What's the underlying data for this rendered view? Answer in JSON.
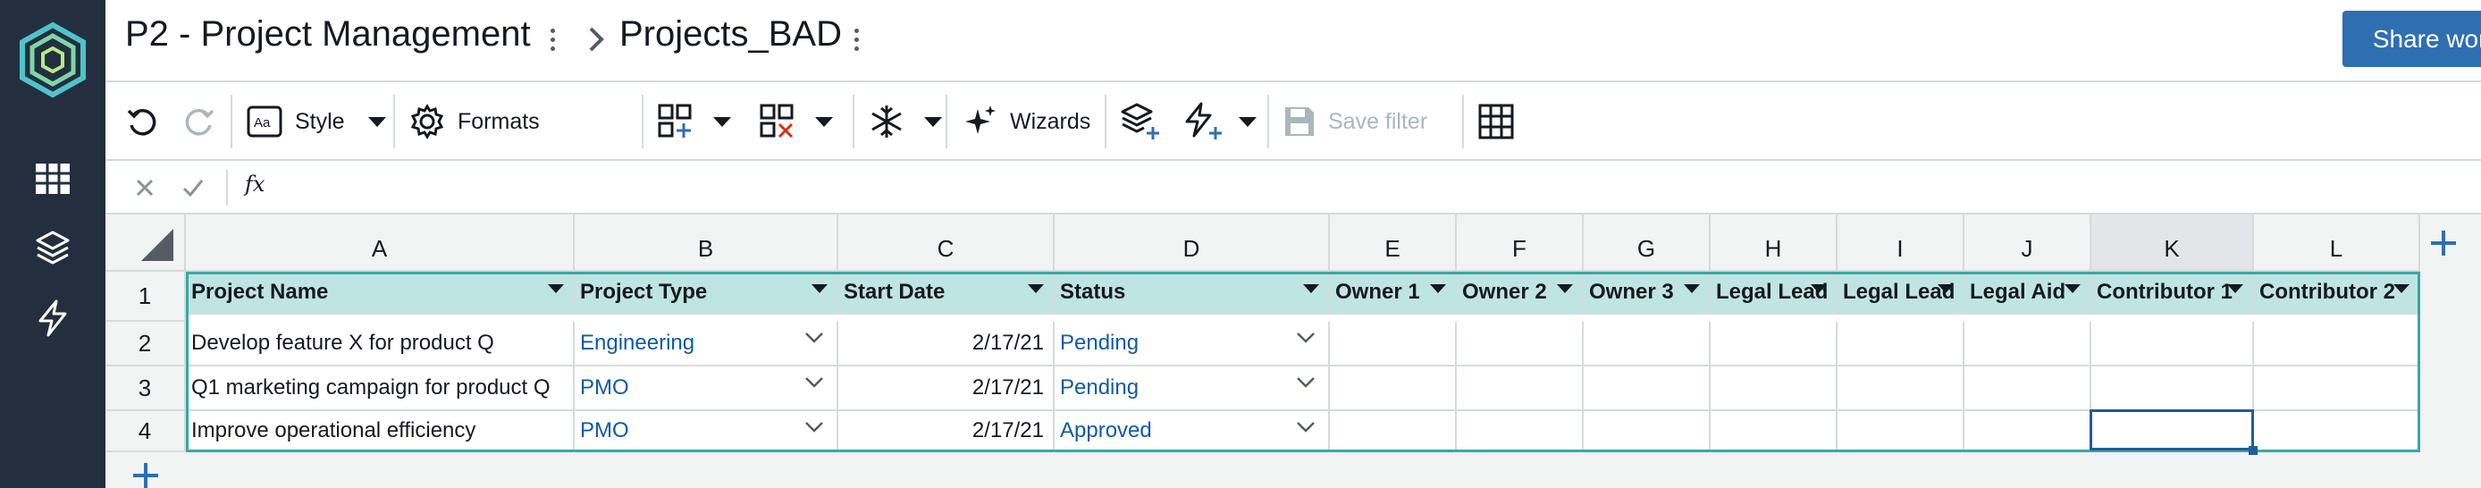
{
  "header": {
    "workbook_title": "P2 - Project Management",
    "sheet_title": "Projects_BAD",
    "share_label": "Share workbook"
  },
  "toolbar": {
    "style_label": "Style",
    "formats_label": "Formats",
    "wizards_label": "Wizards",
    "save_filter_label": "Save filter"
  },
  "formula_bar": {
    "fx_label": "fx",
    "value": ""
  },
  "grid": {
    "columns": [
      "A",
      "B",
      "C",
      "D",
      "E",
      "F",
      "G",
      "H",
      "I",
      "J",
      "K",
      "L"
    ],
    "rows": [
      "1",
      "2",
      "3",
      "4"
    ],
    "header_row": [
      "Project Name",
      "Project Type",
      "Start Date",
      "Status",
      "Owner 1",
      "Owner 2",
      "Owner 3",
      "Legal Lead",
      "Legal Lead",
      "Legal Aid",
      "Contributor 1",
      "Contributor 2"
    ],
    "data": [
      {
        "name": "Develop feature X for product Q",
        "type": "Engineering",
        "start": "2/17/21",
        "status": "Pending"
      },
      {
        "name": "Q1 marketing campaign for product Q",
        "type": "PMO",
        "start": "2/17/21",
        "status": "Pending"
      },
      {
        "name": "Improve operational efficiency",
        "type": "PMO",
        "start": "2/17/21",
        "status": "Approved"
      }
    ],
    "selected_cell": "K4"
  },
  "colors": {
    "nav_bg": "#232f3e",
    "accent_blue": "#2e6fb2",
    "table_header_bg": "#bfe5e3",
    "table_outline": "#3aa7a6",
    "link_text": "#0f5aa6"
  },
  "icons": {
    "logo": "honeycode-hexagon-logo",
    "nav": [
      "tables-icon",
      "layers-icon",
      "automations-bolt-icon"
    ],
    "toolbar": [
      "undo-icon",
      "redo-icon",
      "style-icon",
      "formats-gear-icon",
      "add-row-icon",
      "delete-row-icon",
      "freeze-snowflake-icon",
      "wizards-sparkle-icon",
      "add-layer-icon",
      "add-automation-icon",
      "save-filter-icon",
      "grid-view-icon"
    ]
  }
}
